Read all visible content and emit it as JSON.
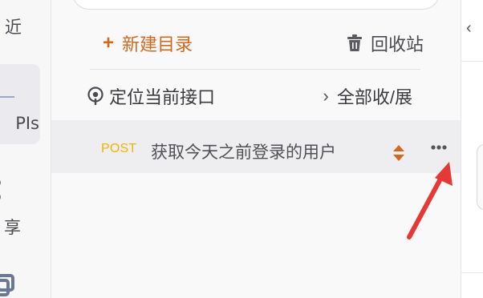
{
  "rail": {
    "recent_label": "近",
    "apis_label": "PIs",
    "share_label": "享",
    "icons": [
      "share-icon",
      "copy-icon"
    ]
  },
  "toolbar": {
    "new_dir_label": "新建目录",
    "recycle_label": "回收站",
    "locate_label": "定位当前接口",
    "toggle_all_label": "全部收/展"
  },
  "tree": {
    "items": [
      {
        "method": "POST",
        "name": "获取今天之前登录的用户"
      }
    ]
  },
  "colors": {
    "accent": "#d2691e",
    "method_post": "#f0b400",
    "annotation": "#e53935",
    "selected_row": "#eeeef0"
  }
}
